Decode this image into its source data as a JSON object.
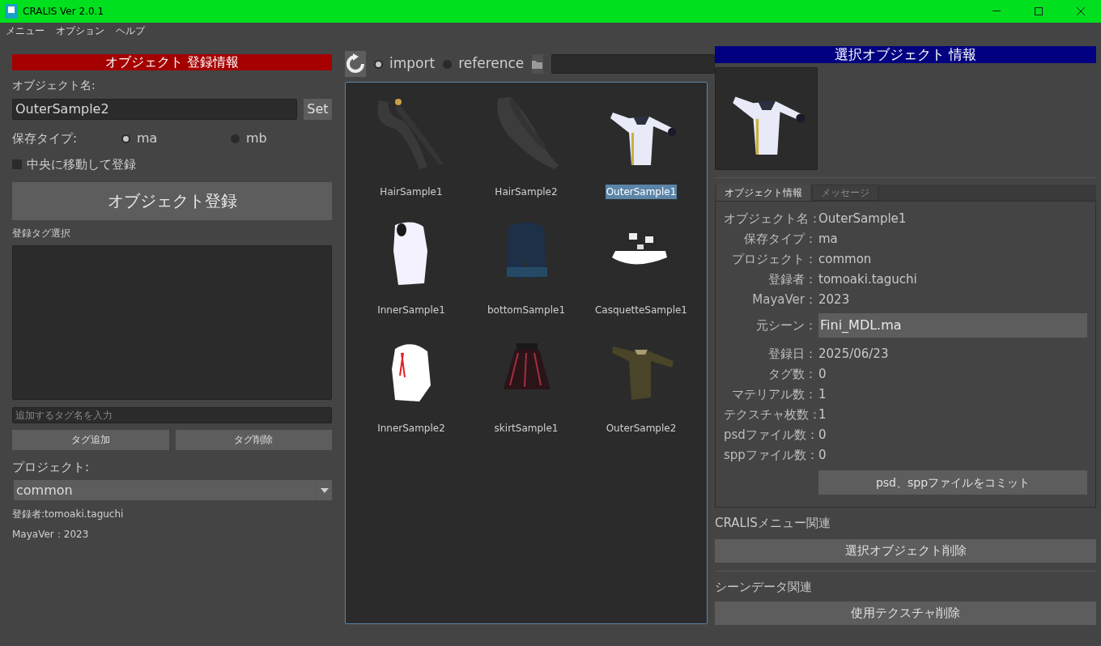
{
  "window": {
    "title": "CRALIS Ver 2.0.1"
  },
  "menu": [
    "メニュー",
    "オプション",
    "ヘルプ"
  ],
  "register_panel": {
    "header": "オブジェクト 登録情報",
    "name_label": "オブジェクト名:",
    "name_value": "OuterSample2",
    "set_button": "Set",
    "save_type_label": "保存タイプ:",
    "save_types": [
      {
        "label": "ma",
        "selected": true
      },
      {
        "label": "mb",
        "selected": false
      }
    ],
    "center_checkbox": {
      "label": "中央に移動して登録",
      "checked": false
    },
    "register_button": "オブジェクト登録",
    "tag_label": "登録タグ選択",
    "tag_placeholder": "追加するタグ名を入力",
    "tag_buttons": [
      "タグ追加",
      "タグ削除"
    ],
    "project_label": "プロジェクト:",
    "project_value": "common",
    "registrant": "登録者:tomoaki.taguchi",
    "maya_ver": "MayaVer：2023"
  },
  "browser": {
    "modes": [
      {
        "label": "import",
        "selected": true
      },
      {
        "label": "reference",
        "selected": false
      }
    ],
    "items": [
      {
        "name": "HairSample1",
        "selected": false
      },
      {
        "name": "HairSample2",
        "selected": false
      },
      {
        "name": "OuterSample1",
        "selected": true
      },
      {
        "name": "InnerSample1",
        "selected": false
      },
      {
        "name": "bottomSample1",
        "selected": false
      },
      {
        "name": "CasquetteSample1",
        "selected": false
      },
      {
        "name": "InnerSample2",
        "selected": false
      },
      {
        "name": "skirtSample1",
        "selected": false
      },
      {
        "name": "OuterSample2",
        "selected": false
      }
    ]
  },
  "info_panel": {
    "header": "選択オブジェクト 情報",
    "tabs": [
      {
        "label": "オブジェクト情報",
        "selected": true
      },
      {
        "label": "メッセージ",
        "selected": false
      }
    ],
    "rows": [
      {
        "label": "オブジェクト名：",
        "value": "OuterSample1",
        "kind": "text"
      },
      {
        "label": "保存タイプ：",
        "value": "ma",
        "kind": "text"
      },
      {
        "label": "プロジェクト：",
        "value": "common",
        "kind": "text"
      },
      {
        "label": "登録者：",
        "value": "tomoaki.taguchi",
        "kind": "text"
      },
      {
        "label": "MayaVer：",
        "value": "2023",
        "kind": "text"
      },
      {
        "label": "元シーン：",
        "value": "Fini_MDL.ma",
        "kind": "field"
      },
      {
        "label": "登録日：",
        "value": "2025/06/23",
        "kind": "text"
      },
      {
        "label": "タグ数：",
        "value": "0",
        "kind": "text"
      },
      {
        "label": "マテリアル数：",
        "value": "1",
        "kind": "text"
      },
      {
        "label": "テクスチャ枚数：",
        "value": "1",
        "kind": "text"
      },
      {
        "label": "psdファイル数：",
        "value": "0",
        "kind": "text"
      },
      {
        "label": "sppファイル数：",
        "value": "0",
        "kind": "text"
      }
    ],
    "commit_button": "psd、sppファイルをコミット",
    "menu_section": "CRALISメニュー関連",
    "delete_button": "選択オブジェクト削除",
    "scene_section": "シーンデータ関連",
    "texture_button": "使用テクスチャ削除"
  }
}
